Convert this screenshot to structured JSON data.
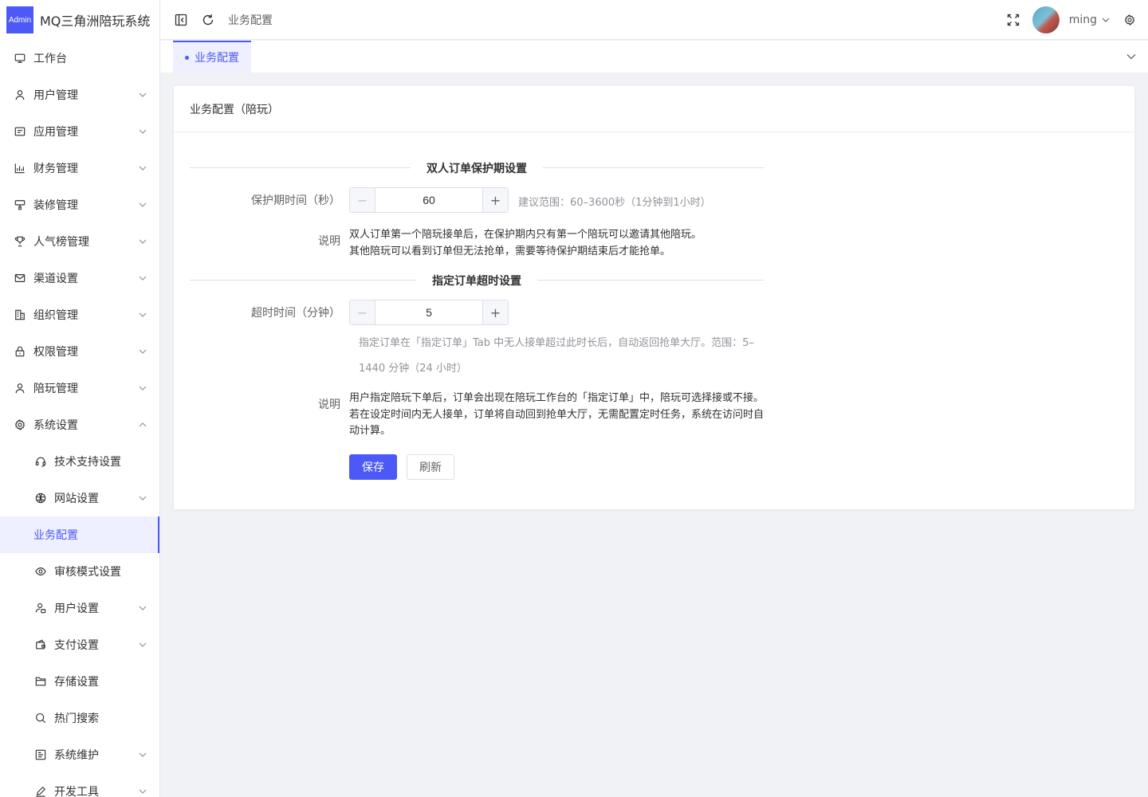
{
  "app": {
    "logo_badge": "Admin",
    "title": "MQ三角洲陪玩系统"
  },
  "sidebar": {
    "items": [
      {
        "label": "工作台",
        "icon": "monitor-icon",
        "has_arrow": false
      },
      {
        "label": "用户管理",
        "icon": "user-icon",
        "has_arrow": true
      },
      {
        "label": "应用管理",
        "icon": "app-icon",
        "has_arrow": true
      },
      {
        "label": "财务管理",
        "icon": "chart-icon",
        "has_arrow": true
      },
      {
        "label": "装修管理",
        "icon": "brush-icon",
        "has_arrow": true
      },
      {
        "label": "人气榜管理",
        "icon": "trophy-icon",
        "has_arrow": true
      },
      {
        "label": "渠道设置",
        "icon": "mail-icon",
        "has_arrow": true
      },
      {
        "label": "组织管理",
        "icon": "building-icon",
        "has_arrow": true
      },
      {
        "label": "权限管理",
        "icon": "lock-icon",
        "has_arrow": true
      },
      {
        "label": "陪玩管理",
        "icon": "user-icon",
        "has_arrow": true
      },
      {
        "label": "系统设置",
        "icon": "gear-icon",
        "has_arrow": true,
        "expanded": true
      }
    ],
    "sub_items": [
      {
        "label": "技术支持设置",
        "icon": "headset-icon",
        "has_arrow": false
      },
      {
        "label": "网站设置",
        "icon": "globe-icon",
        "has_arrow": true
      },
      {
        "label": "业务配置",
        "icon": "",
        "has_arrow": false,
        "active": true
      },
      {
        "label": "审核模式设置",
        "icon": "eye-icon",
        "has_arrow": false
      },
      {
        "label": "用户设置",
        "icon": "user-settings-icon",
        "has_arrow": true
      },
      {
        "label": "支付设置",
        "icon": "wallet-icon",
        "has_arrow": true
      },
      {
        "label": "存储设置",
        "icon": "folder-icon",
        "has_arrow": false
      },
      {
        "label": "热门搜索",
        "icon": "search-icon",
        "has_arrow": false
      },
      {
        "label": "系统维护",
        "icon": "maintenance-icon",
        "has_arrow": true
      },
      {
        "label": "开发工具",
        "icon": "pen-icon",
        "has_arrow": true
      }
    ]
  },
  "header": {
    "breadcrumb": "业务配置",
    "username": "ming"
  },
  "tabs": [
    {
      "label": "业务配置",
      "active": true
    }
  ],
  "card": {
    "title": "业务配置（陪玩）",
    "section1": {
      "title": "双人订单保护期设置",
      "field_label": "保护期时间（秒）",
      "value": "60",
      "hint": "建议范围：60–3600秒（1分钟到1小时）",
      "desc_label": "说明",
      "desc_line1": "双人订单第一个陪玩接单后，在保护期内只有第一个陪玩可以邀请其他陪玩。",
      "desc_line2": "其他陪玩可以看到订单但无法抢单，需要等待保护期结束后才能抢单。"
    },
    "section2": {
      "title": "指定订单超时设置",
      "field_label": "超时时间（分钟）",
      "value": "5",
      "hint_line1": "指定订单在「指定订单」Tab 中无人接单超过此时长后，自动返回抢单大厅。范围：5–",
      "hint_line2": "1440 分钟（24 小时）",
      "desc_label": "说明",
      "desc_line1": "用户指定陪玩下单后，订单会出现在陪玩工作台的「指定订单」中，陪玩可选择接或不接。",
      "desc_line2": "若在设定时间内无人接单，订单将自动回到抢单大厅，无需配置定时任务，系统在访问时自",
      "desc_line3": "动计算。"
    },
    "save_label": "保存",
    "refresh_label": "刷新"
  },
  "colors": {
    "primary": "#4c59f6",
    "active_bg": "#eef0ff"
  }
}
